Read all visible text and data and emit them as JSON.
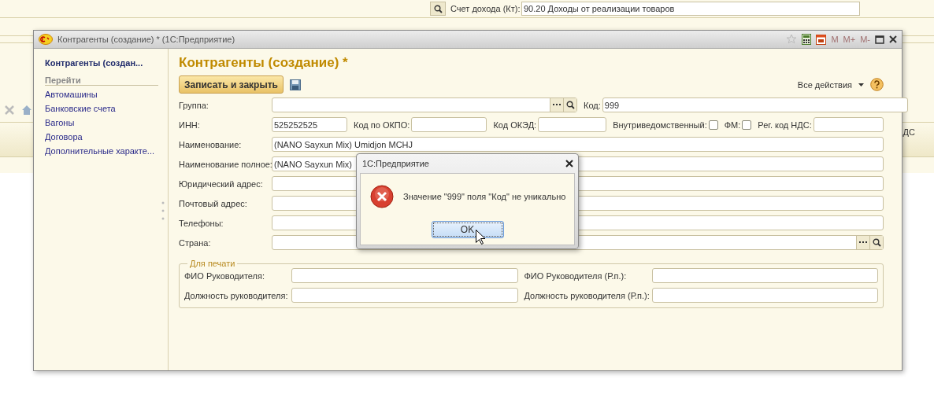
{
  "background": {
    "income_account": {
      "label": "Счет дохода (Кт):",
      "value": "90.20 Доходы от реализации товаров"
    },
    "column_fragment": "ДС"
  },
  "window": {
    "title": "Контрагенты (создание) *  (1С:Предприятие)",
    "memory_buttons": [
      {
        "label": "M",
        "disabled": true
      },
      {
        "label": "M+",
        "disabled": true
      },
      {
        "label": "M-",
        "disabled": true
      }
    ]
  },
  "sidebar": {
    "current": "Контрагенты (создан...",
    "section": "Перейти",
    "items": [
      "Автомашины",
      "Банковские счета",
      "Вагоны",
      "Договора",
      "Дополнительные характе..."
    ]
  },
  "form": {
    "title": "Контрагенты (создание) *",
    "save_close_button": "Записать и закрыть",
    "all_actions": "Все действия",
    "rows": [
      {
        "label": "Группа:",
        "kind": "picker",
        "search": true,
        "extras": [
          {
            "label": "Код:",
            "kind": "input",
            "value": "999"
          }
        ]
      },
      {
        "label": "ИНН:",
        "kind": "input",
        "value": "525252525",
        "extras": [
          {
            "label": "Код по ОКПО:",
            "kind": "input"
          },
          {
            "label": "Код ОКЭД:",
            "kind": "input"
          },
          {
            "label": "Внутриведомственный:",
            "kind": "checkbox",
            "checked": false
          },
          {
            "label": "ФМ:",
            "kind": "checkbox",
            "checked": false
          },
          {
            "label": "Рег. код НДС:",
            "kind": "input"
          }
        ]
      },
      {
        "label": "Наименование:",
        "kind": "input",
        "value": "(NANO Sayxun Mix) Umidjon MCHJ"
      },
      {
        "label": "Наименование полное:",
        "kind": "input",
        "value": "(NANO Sayxun Mix)"
      },
      {
        "label": "Юридический адрес:",
        "kind": "input"
      },
      {
        "label": "Почтовый адрес:",
        "kind": "input"
      },
      {
        "label": "Телефоны:",
        "kind": "input"
      },
      {
        "label": "Страна:",
        "kind": "picker",
        "search": true
      }
    ],
    "print_group": {
      "title": "Для печати",
      "fields": [
        {
          "label": "ФИО Руководителя:"
        },
        {
          "label": "ФИО Руководителя (Р.п.):"
        },
        {
          "label": "Должность руководителя:"
        },
        {
          "label": "Должность руководителя (Р.п.):"
        }
      ]
    }
  },
  "dialog": {
    "title": "1С:Предприятие",
    "message": "Значение \"999\" поля \"Код\" не уникально",
    "buttons": [
      {
        "label": "OK",
        "selected": true
      }
    ]
  }
}
